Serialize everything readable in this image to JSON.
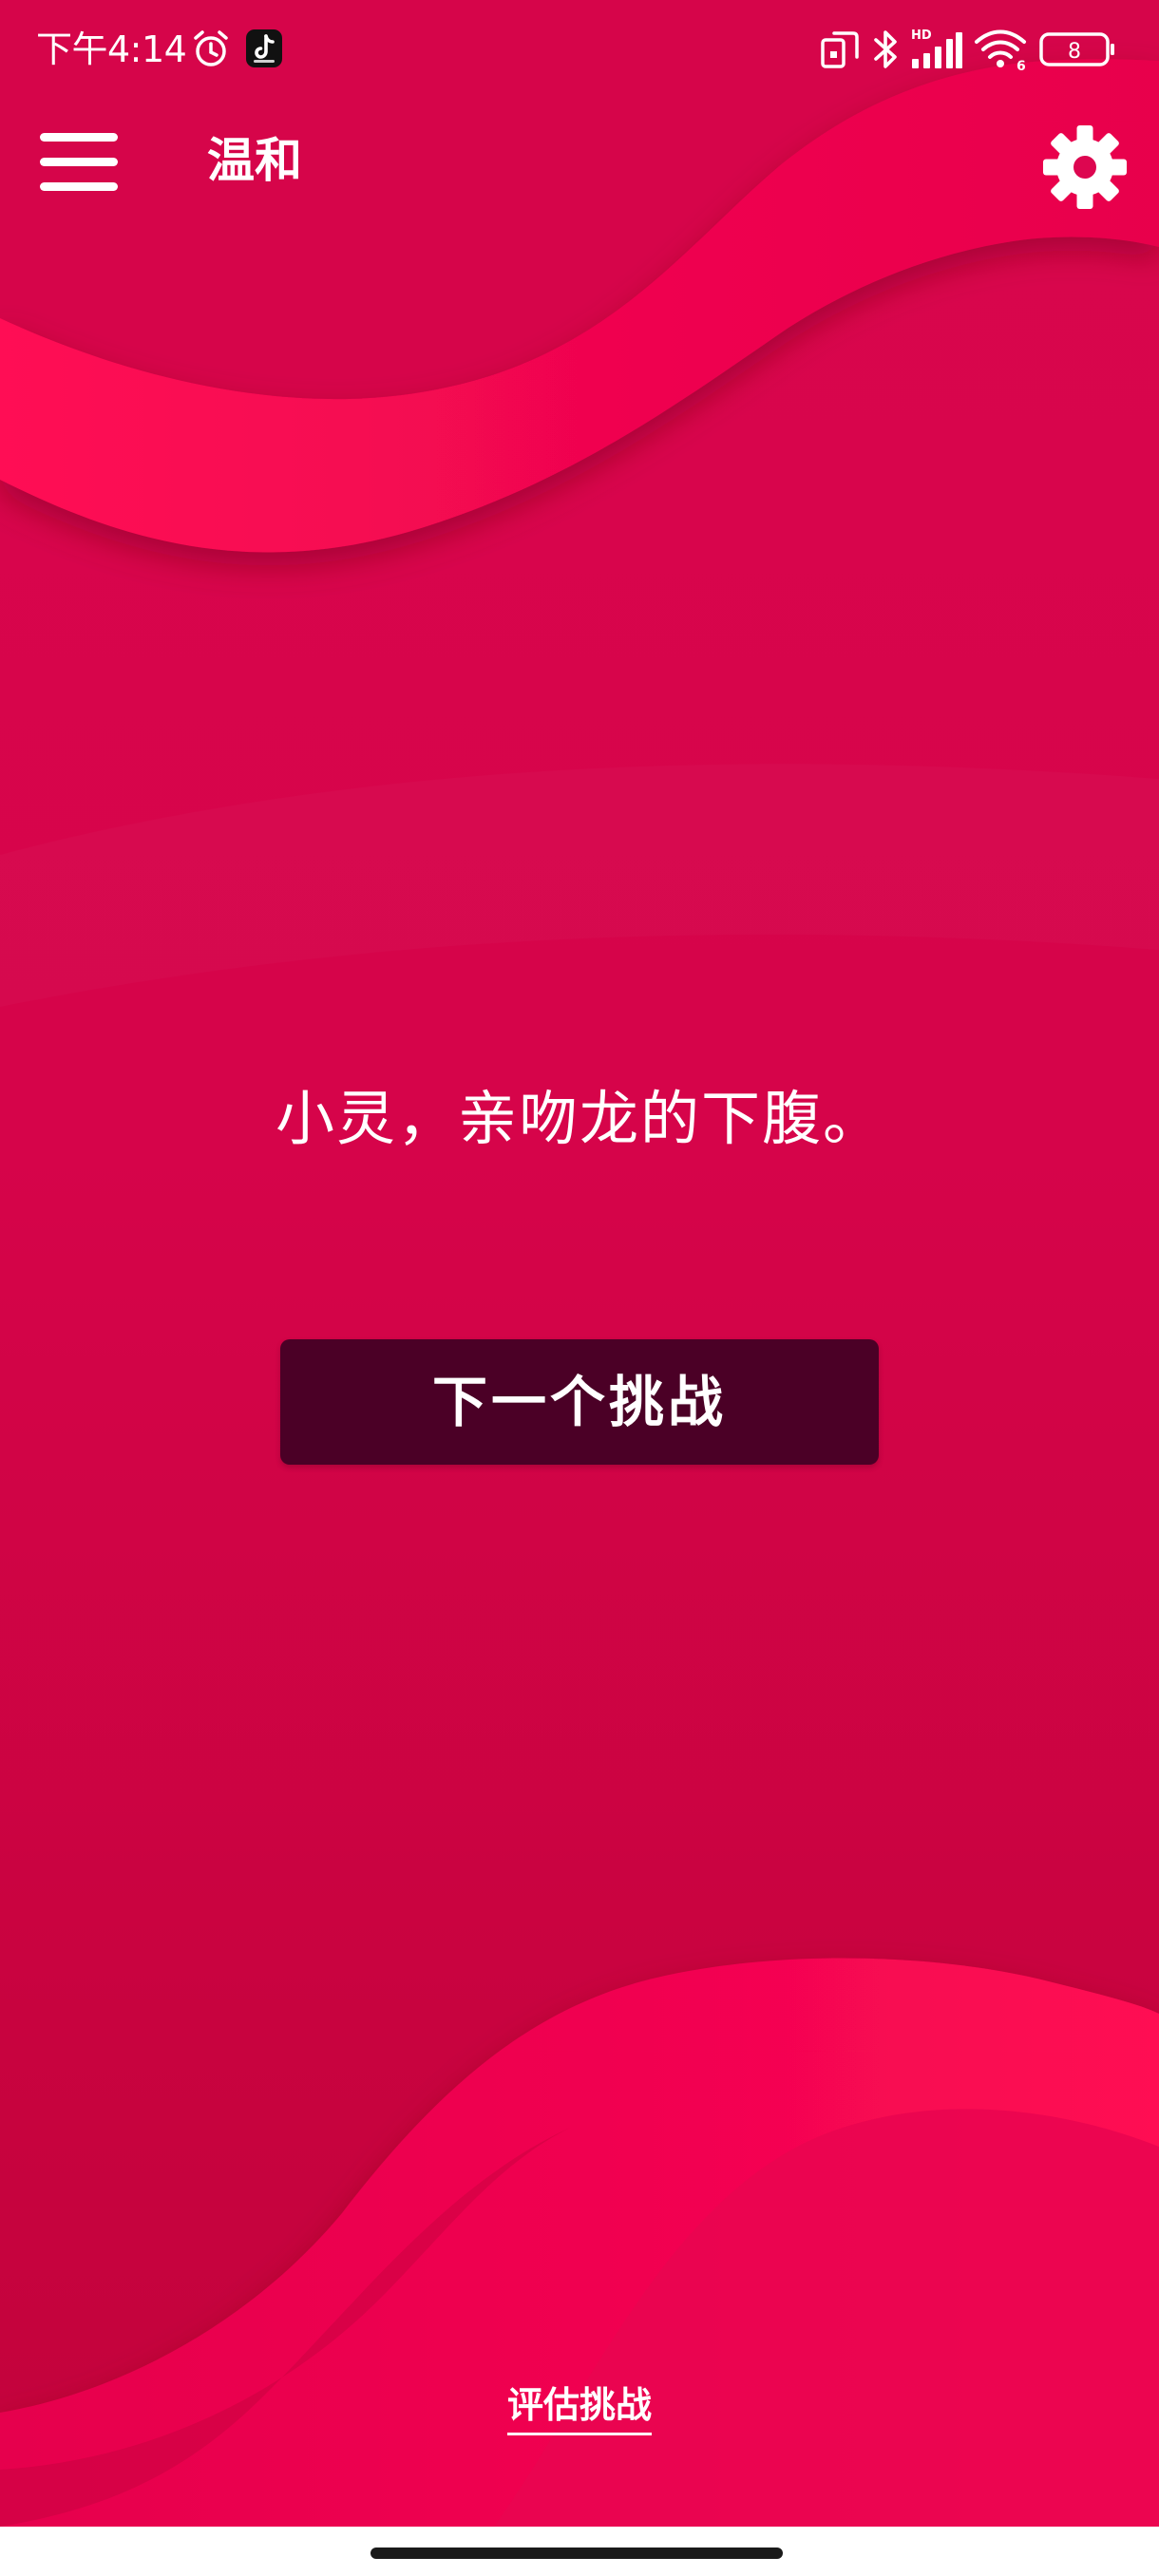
{
  "status_bar": {
    "time": "下午4:14",
    "icons": [
      "alarm-icon",
      "tiktok-app-icon",
      "nfc-icon",
      "bluetooth-icon",
      "hd-signal-icon",
      "wifi-icon",
      "battery-icon"
    ],
    "hd_label": "HD",
    "wifi_generation": "6",
    "battery_level": "8"
  },
  "app_bar": {
    "title": "温和",
    "menu_icon": "hamburger-menu-icon",
    "settings_icon": "gear-icon"
  },
  "main": {
    "challenge_text": "小灵，亲吻龙的下腹。",
    "next_button_label": "下一个挑战",
    "rate_link_label": "评估挑战"
  },
  "theme": {
    "background": "#d6044a",
    "wave_highlight": "#ff0a52",
    "button_background": "#4b0026",
    "text": "#ffffff"
  }
}
